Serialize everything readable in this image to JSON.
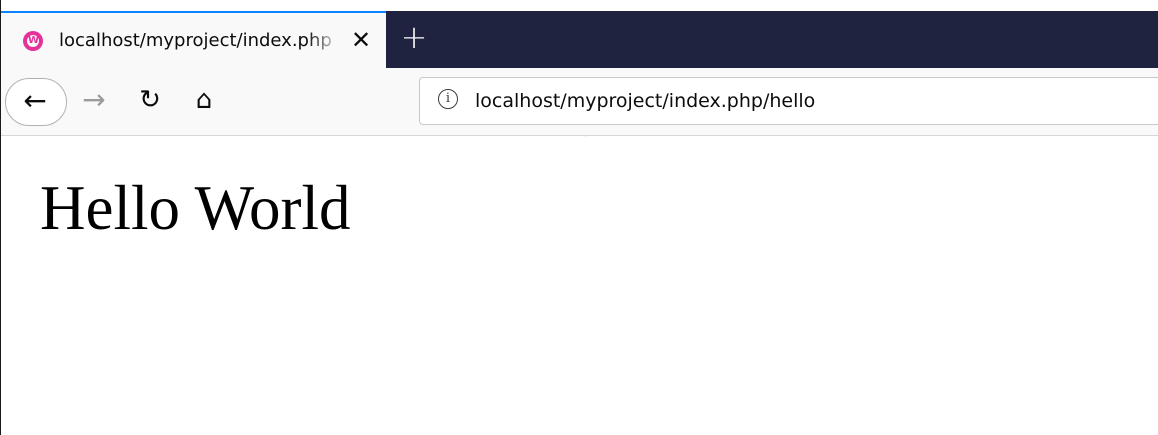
{
  "browser": {
    "tab": {
      "title": "localhost/myproject/index.php",
      "favicon": "wampserver-w-icon",
      "close_glyph": "✕"
    },
    "new_tab_glyph": "+",
    "toolbar": {
      "back_glyph": "←",
      "forward_glyph": "→",
      "reload_glyph": "↻",
      "home_glyph": "⌂"
    },
    "urlbar": {
      "info_glyph": "i",
      "url": "localhost/myproject/index.php/hello"
    },
    "colors": {
      "tabstrip_bg": "#202340",
      "active_tab_accent": "#0a84ff",
      "favicon": "#e5329a"
    }
  },
  "page": {
    "heading": "Hello World"
  }
}
